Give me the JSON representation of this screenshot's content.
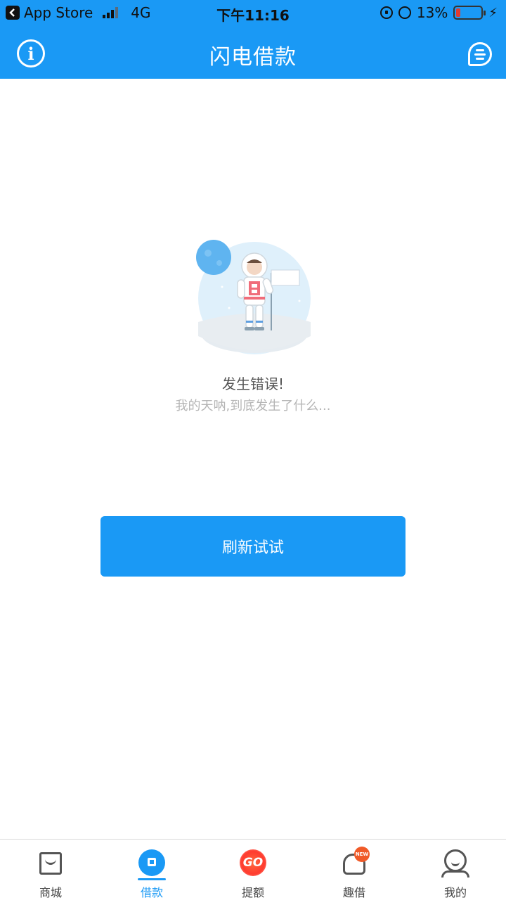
{
  "status_bar": {
    "back_app": "App Store",
    "network": "4G",
    "time": "下午11:16",
    "battery": "13%"
  },
  "nav": {
    "title": "闪电借款",
    "info_icon": "info-icon",
    "message_icon": "message-icon"
  },
  "error": {
    "title": "发生错误!",
    "subtitle": "我的天呐,到底发生了什么..."
  },
  "refresh_button": "刷新试试",
  "tabs": [
    {
      "label": "商城",
      "icon": "shop-icon",
      "active": false
    },
    {
      "label": "借款",
      "icon": "loan-icon",
      "active": true
    },
    {
      "label": "提额",
      "icon": "go-icon",
      "badge": "GO",
      "active": false
    },
    {
      "label": "趣借",
      "icon": "fun-loan-icon",
      "badge": "NEW",
      "active": false
    },
    {
      "label": "我的",
      "icon": "profile-icon",
      "active": false
    }
  ],
  "colors": {
    "primary": "#1a99f5",
    "battery_low": "#e23b30",
    "badge": "#f05a28"
  }
}
